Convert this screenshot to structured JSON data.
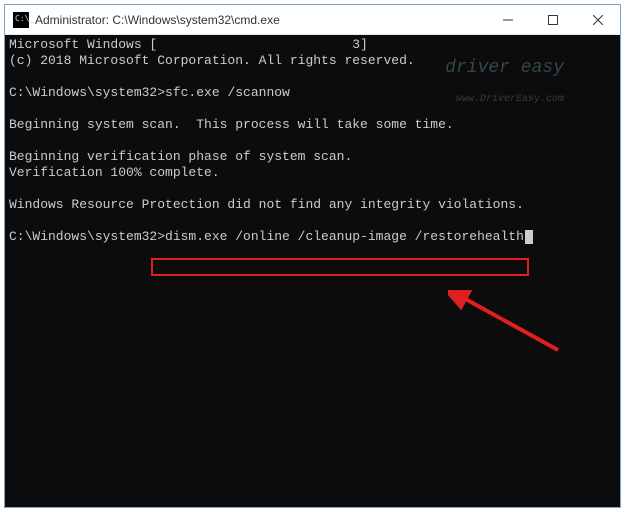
{
  "window": {
    "title": "Administrator: C:\\Windows\\system32\\cmd.exe"
  },
  "watermark": {
    "brand": "driver easy",
    "url": "www.DriverEasy.com"
  },
  "console": {
    "line1": "Microsoft Windows [                         3]",
    "line2": "(c) 2018 Microsoft Corporation. All rights reserved.",
    "blank1": "",
    "line3_prompt": "C:\\Windows\\system32>",
    "line3_cmd": "sfc.exe /scannow",
    "blank2": "",
    "line4": "Beginning system scan.  This process will take some time.",
    "blank3": "",
    "line5": "Beginning verification phase of system scan.",
    "line6": "Verification 100% complete.",
    "blank4": "",
    "line7": "Windows Resource Protection did not find any integrity violations.",
    "blank5": "",
    "line8_prompt": "C:\\Windows\\system32>",
    "line8_cmd": "dism.exe /online /cleanup-image /restorehealth"
  }
}
